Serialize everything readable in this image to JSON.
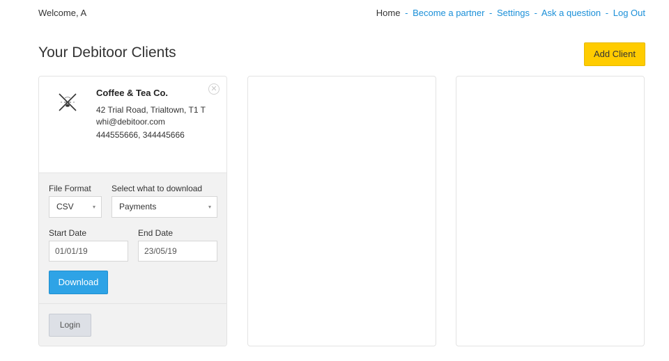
{
  "header": {
    "welcome": "Welcome, A",
    "nav": {
      "home": "Home",
      "become_partner": "Become a partner",
      "settings": "Settings",
      "ask_question": "Ask a question",
      "logout": "Log Out",
      "separator": "-"
    }
  },
  "page": {
    "title": "Your Debitoor Clients",
    "add_client_label": "Add Client"
  },
  "client_card": {
    "close_glyph": "✕",
    "name": "Coffee & Tea Co.",
    "address": "42 Trial Road, Trialtown, T1 T",
    "email": "whi@debitoor.com",
    "phones": "444555666, 344445666",
    "download": {
      "file_format_label": "File Format",
      "file_format_value": "CSV",
      "select_label": "Select what to download",
      "select_value": "Payments",
      "start_date_label": "Start Date",
      "start_date_value": "01/01/19",
      "end_date_label": "End Date",
      "end_date_value": "23/05/19",
      "download_label": "Download"
    },
    "login_label": "Login"
  },
  "icons": {
    "caret": "▾",
    "logo": "coffee-logo-icon",
    "close": "close-icon"
  },
  "colors": {
    "link": "#1a8fd8",
    "add_client_bg": "#ffcc00",
    "download_bg": "#2ea3e6",
    "login_bg": "#dde0e6",
    "panel_bg": "#f2f2f2"
  }
}
